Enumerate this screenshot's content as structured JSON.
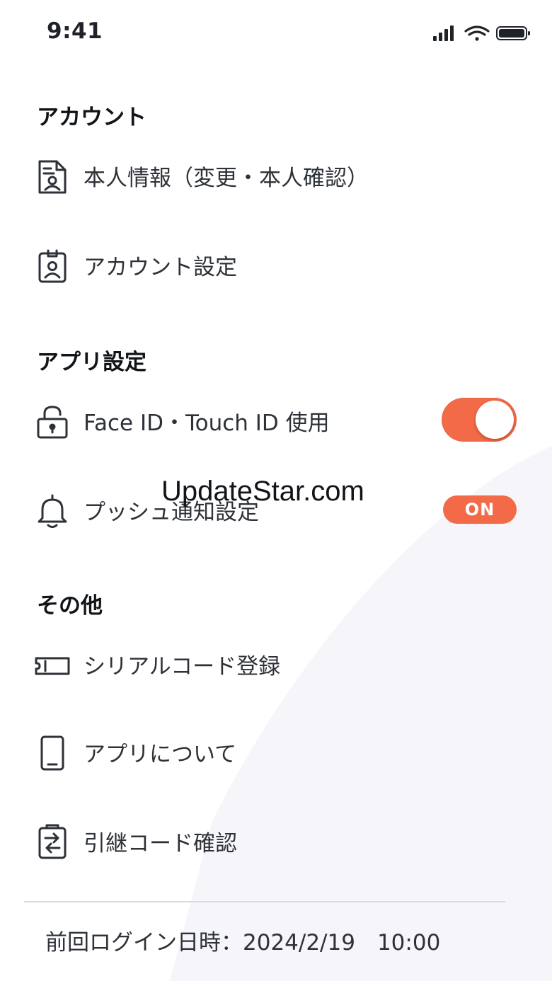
{
  "status_bar": {
    "time": "9:41"
  },
  "sections": {
    "account": {
      "title": "アカウント",
      "items": [
        {
          "label": "本人情報（変更・本人確認）",
          "icon": "id-document-icon"
        },
        {
          "label": "アカウント設定",
          "icon": "id-badge-icon"
        }
      ]
    },
    "app_settings": {
      "title": "アプリ設定",
      "items": [
        {
          "label": "Face ID・Touch ID 使用",
          "icon": "unlock-icon",
          "toggle_on": true
        },
        {
          "label": "プッシュ通知設定",
          "icon": "bell-icon",
          "badge": "ON"
        }
      ]
    },
    "other": {
      "title": "その他",
      "items": [
        {
          "label": "シリアルコード登録",
          "icon": "ticket-icon"
        },
        {
          "label": "アプリについて",
          "icon": "smartphone-icon"
        },
        {
          "label": "引継コード確認",
          "icon": "transfer-icon"
        }
      ]
    }
  },
  "watermark": "UpdateStar.com",
  "footer": {
    "last_login": "前回ログイン日時：2024/2/19　10:00"
  },
  "colors": {
    "accent": "#f26a47",
    "text": "#2d3138",
    "divider": "#d9dbe0"
  }
}
